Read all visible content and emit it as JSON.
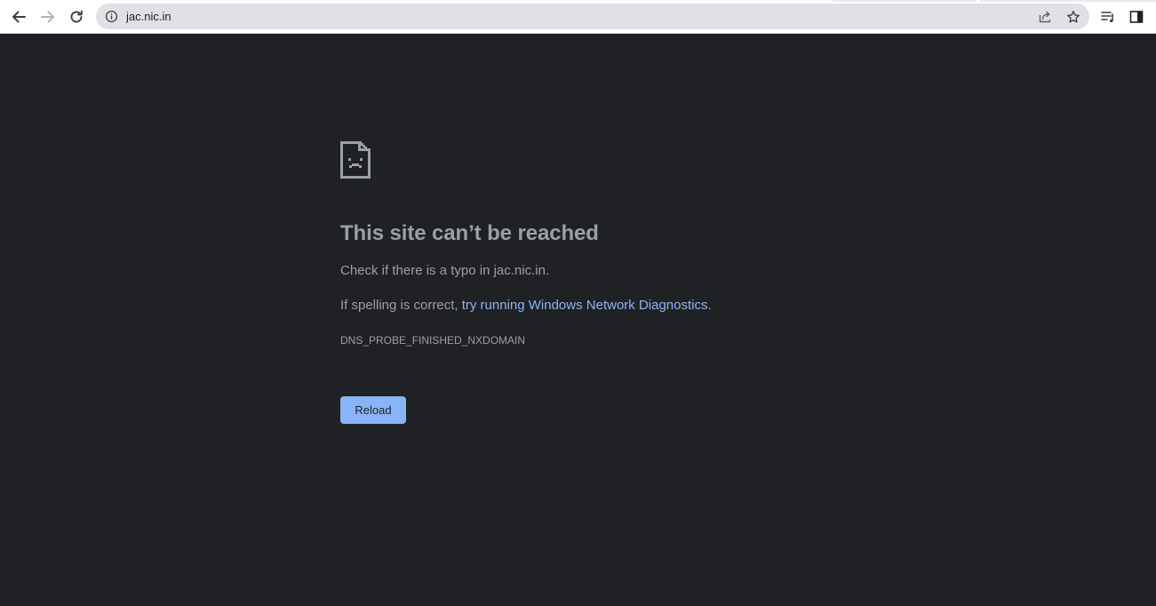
{
  "browser": {
    "url": "jac.nic.in",
    "icons": {
      "back": "back-arrow-icon",
      "forward": "forward-arrow-icon",
      "reload": "reload-icon",
      "site_info": "info-icon",
      "share": "share-icon",
      "bookmark": "star-icon",
      "reading_list": "reading-list-icon",
      "side_panel": "side-panel-icon"
    }
  },
  "error_page": {
    "icon": "sad-page-icon",
    "title": "This site can’t be reached",
    "typo_hint": "Check if there is a typo in jac.nic.in.",
    "diagnostics_prefix": "If spelling is correct, ",
    "diagnostics_link": "try running Windows Network Diagnostics",
    "diagnostics_suffix": ".",
    "error_code": "DNS_PROBE_FINISHED_NXDOMAIN",
    "reload_button": "Reload"
  },
  "colors": {
    "page_background": "#202124",
    "text": "#9aa0a6",
    "link": "#8ab4f8",
    "button": "#8ab4f8"
  }
}
